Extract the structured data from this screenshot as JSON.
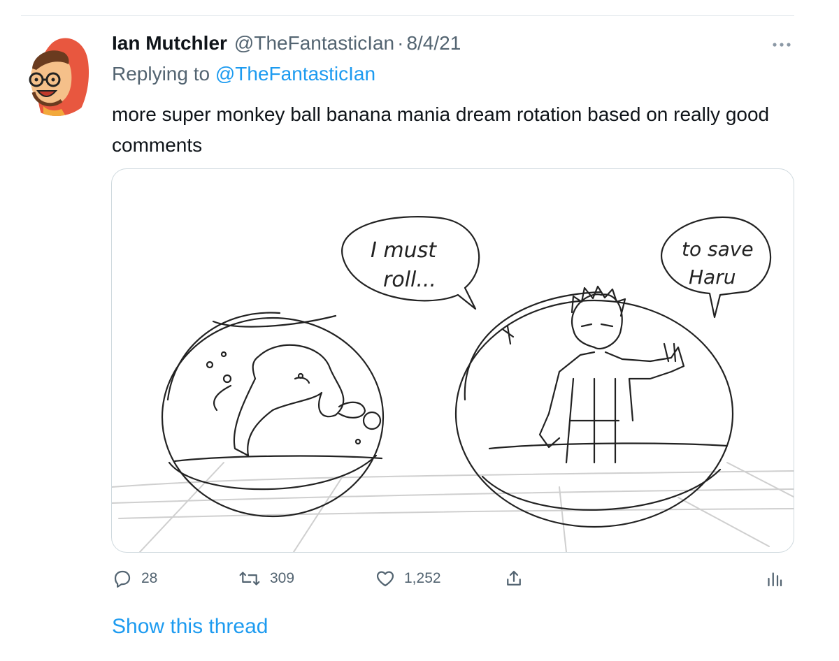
{
  "tweet": {
    "author": {
      "display_name": "Ian Mutchler",
      "handle": "@TheFantasticIan",
      "date": "8/4/21"
    },
    "separator": "·",
    "replying_prefix": "Replying to ",
    "replying_to": "@TheFantasticIan",
    "text": "more super monkey ball banana mania dream rotation based on really good comments",
    "media": {
      "speech_left": [
        "I must",
        "roll..."
      ],
      "speech_right": [
        "to save",
        "Haru"
      ]
    },
    "stats": {
      "replies": "28",
      "retweets": "309",
      "likes": "1,252"
    },
    "show_thread_label": "Show this thread",
    "icons": [
      "more-icon",
      "reply-icon",
      "retweet-icon",
      "like-icon",
      "share-icon",
      "analytics-icon"
    ],
    "colors": {
      "link": "#1d9bf0",
      "muted": "#536471",
      "text": "#0f1419",
      "avatar_bg": "#e8573f"
    }
  }
}
